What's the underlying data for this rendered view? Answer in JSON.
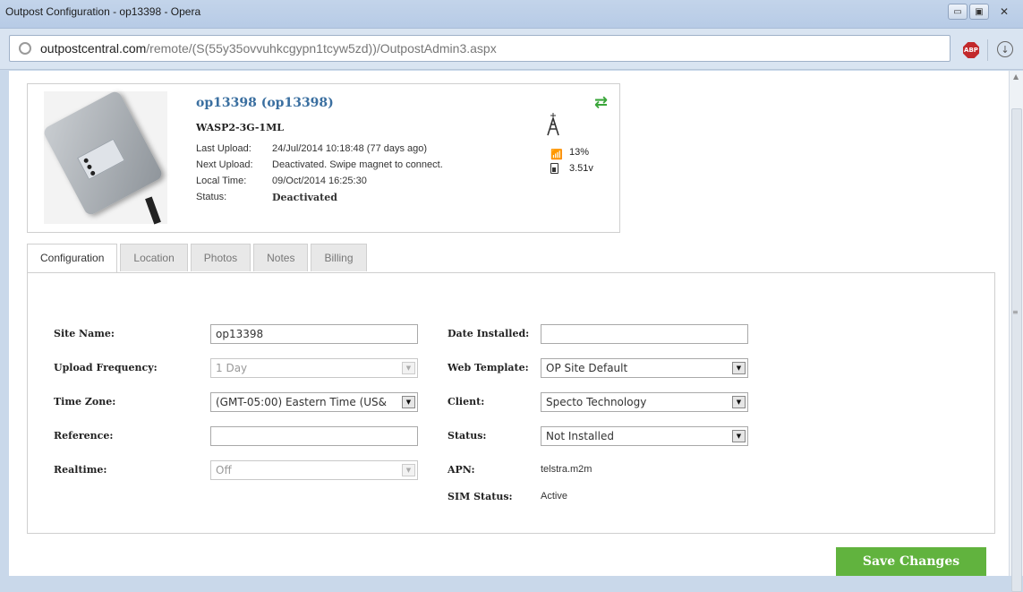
{
  "window": {
    "title": "Outpost Configuration - op13398 - Opera",
    "min_icon": "minimize-icon",
    "max_icon": "maximize-icon",
    "close_icon": "close-icon"
  },
  "address": {
    "domain": "outpostcentral.com",
    "path": "/remote/(S(55y35ovvuhkcgypn1tcyw5zd))/OutpostAdmin3.aspx",
    "abp_label": "ABP"
  },
  "device": {
    "name": "op13398 (op13398)",
    "model": "WASP2-3G-1ML",
    "info": [
      {
        "label": "Last Upload:",
        "value": "24/Jul/2014 10:18:48 (77 days ago)"
      },
      {
        "label": "Next Upload:",
        "value": "Deactivated. Swipe magnet to connect."
      },
      {
        "label": "Local Time:",
        "value": "09/Oct/2014 16:25:30"
      },
      {
        "label": "Status:",
        "value": "Deactivated"
      }
    ],
    "signal": "13%",
    "battery": "3.51v"
  },
  "tabs": [
    {
      "label": "Configuration",
      "active": true
    },
    {
      "label": "Location"
    },
    {
      "label": "Photos"
    },
    {
      "label": "Notes"
    },
    {
      "label": "Billing"
    }
  ],
  "form": {
    "site_name": {
      "label": "Site Name:",
      "value": "op13398"
    },
    "upload_frequency": {
      "label": "Upload Frequency:",
      "value": "1 Day"
    },
    "time_zone": {
      "label": "Time Zone:",
      "value": "(GMT-05:00) Eastern Time (US&"
    },
    "reference": {
      "label": "Reference:",
      "value": ""
    },
    "realtime": {
      "label": "Realtime:",
      "value": "Off"
    },
    "date_installed": {
      "label": "Date Installed:",
      "value": ""
    },
    "web_template": {
      "label": "Web Template:",
      "value": "OP Site Default"
    },
    "client": {
      "label": "Client:",
      "value": "Specto Technology"
    },
    "status": {
      "label": "Status:",
      "value": "Not Installed"
    },
    "apn": {
      "label": "APN:",
      "value": "telstra.m2m"
    },
    "sim_status": {
      "label": "SIM Status:",
      "value": "Active"
    }
  },
  "save_label": "Save Changes",
  "colors": {
    "accent_green": "#61b33e",
    "link_blue": "#3a6fa0"
  }
}
